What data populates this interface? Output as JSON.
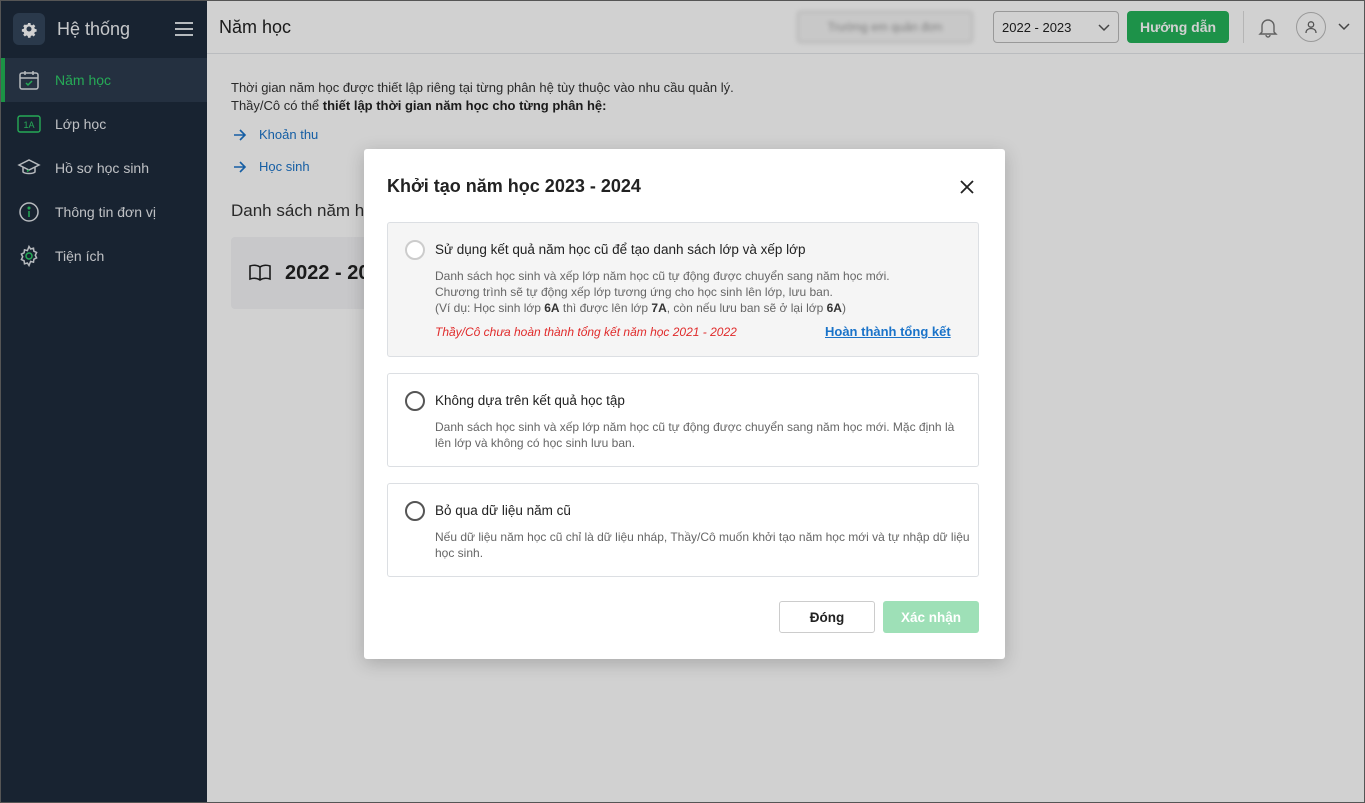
{
  "sidebar": {
    "title": "Hệ thống",
    "items": [
      {
        "label": "Năm học",
        "icon": "calendar-icon",
        "active": true
      },
      {
        "label": "Lớp học",
        "icon": "class-1a-icon"
      },
      {
        "label": "Hồ sơ học sinh",
        "icon": "graduation-cap-icon"
      },
      {
        "label": "Thông tin đơn vị",
        "icon": "info-icon"
      },
      {
        "label": "Tiện ích",
        "icon": "gear-icon"
      }
    ]
  },
  "header": {
    "title": "Năm học",
    "blurred_text": "Trường em quản đơn",
    "year_selected": "2022 - 2023",
    "guide_label": "Hướng dẫn"
  },
  "main": {
    "intro_line1": "Thời gian năm học được thiết lập riêng tại từng phân hệ tùy thuộc vào nhu cầu quản lý.",
    "intro_line2_prefix": "Thầy/Cô có thể ",
    "intro_line2_bold": "thiết lập thời gian năm học cho từng phân hệ:",
    "links": [
      "Khoản thu",
      "Học sinh"
    ],
    "list_title": "Danh sách năm học",
    "year_card": "2022 - 2023"
  },
  "modal": {
    "title": "Khởi tạo năm học 2023 - 2024",
    "options": [
      {
        "title": "Sử dụng kết quả năm học cũ để tạo danh sách lớp và xếp lớp",
        "desc_line1": "Danh sách học sinh và xếp lớp năm học cũ tự động được chuyển sang năm học mới.",
        "desc_line2": "Chương trình sẽ tự động xếp lớp tương ứng cho học sinh lên lớp, lưu ban.",
        "desc_line3_a": "(Ví dụ: Học sinh lớp ",
        "desc_line3_b": "6A",
        "desc_line3_c": " thì được lên lớp ",
        "desc_line3_d": "7A",
        "desc_line3_e": ", còn nếu lưu ban sẽ ở lại lớp ",
        "desc_line3_f": "6A",
        "desc_line3_g": ")",
        "warning": "Thầy/Cô chưa hoàn thành tổng kết năm học 2021 - 2022",
        "action_link": "Hoàn thành tổng kết",
        "disabled": true
      },
      {
        "title": "Không dựa trên kết quả học tập",
        "desc": "Danh sách học sinh và xếp lớp năm học cũ tự động được chuyển sang năm học mới. Mặc định là lên lớp và không có học sinh lưu ban."
      },
      {
        "title": "Bỏ qua dữ liệu năm cũ",
        "desc": "Nếu dữ liệu năm học cũ chỉ là dữ liệu nháp, Thầy/Cô muốn khởi tạo năm học mới và tự nhập dữ liệu học sinh."
      }
    ],
    "close_label": "Đóng",
    "confirm_label": "Xác nhận"
  },
  "colors": {
    "sidebar_bg": "#1e2b3c",
    "accent_green": "#22b455",
    "link_blue": "#1a73c9",
    "warning_red": "#e02b2b"
  }
}
